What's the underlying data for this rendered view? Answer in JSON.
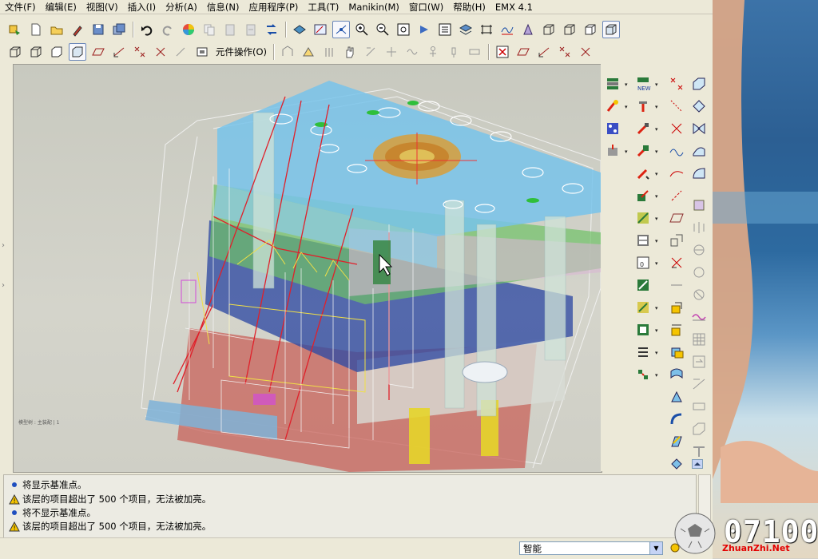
{
  "menubar": {
    "items": [
      "文件(F)",
      "编辑(E)",
      "视图(V)",
      "插入(I)",
      "分析(A)",
      "信息(N)",
      "应用程序(P)",
      "工具(T)",
      "Manikin(M)",
      "窗口(W)",
      "帮助(H)",
      "EMX 4.1"
    ]
  },
  "toolbar2": {
    "component_ops_label": "元件操作(O)"
  },
  "viewport": {
    "corner_label": "模型树 : 主装配 | 1"
  },
  "messages": [
    {
      "type": "info",
      "text": "将显示基准点。"
    },
    {
      "type": "warning",
      "text": "该层的项目超出了 500 个项目，无法被加亮。"
    },
    {
      "type": "info",
      "text": "将不显示基准点。"
    },
    {
      "type": "warning",
      "text": "该层的项目超出了 500 个项目，无法被加亮。"
    }
  ],
  "statusbar": {
    "filter_value": "智能"
  },
  "watermark": {
    "digits": "07100",
    "site": "ZhuanZhi.Net"
  },
  "colors": {
    "accent": "#2d6aa0",
    "warning": "#f5c400",
    "info": "#1f4fbf"
  }
}
